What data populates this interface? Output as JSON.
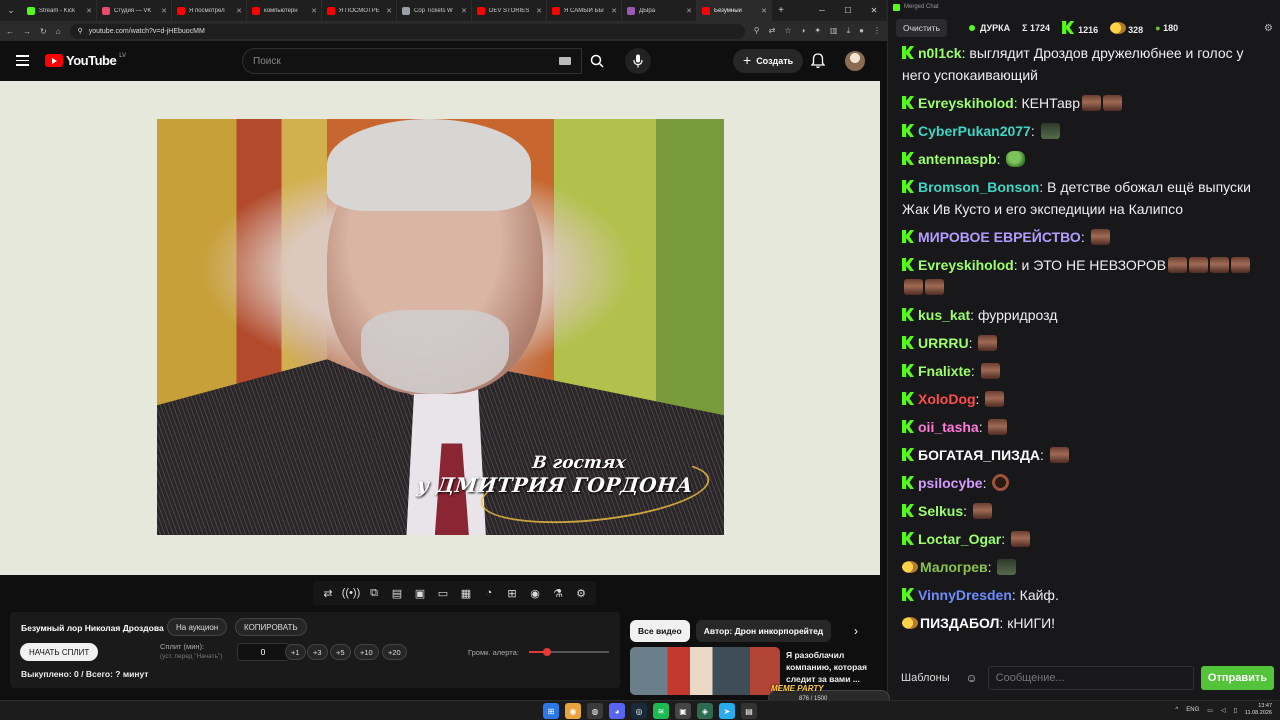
{
  "browser": {
    "tabs": [
      {
        "title": "Stream - Kick",
        "color": "#53fc18",
        "active": false
      },
      {
        "title": "Студия — VK",
        "color": "#e84a6a",
        "active": false
      },
      {
        "title": "Я посмотрел",
        "color": "#ff0000",
        "active": false
      },
      {
        "title": "компьютерн",
        "color": "#ff0000",
        "active": false
      },
      {
        "title": "Я ПОСМОТРЕ",
        "color": "#ff0000",
        "active": false
      },
      {
        "title": "Cop Tickets W",
        "color": "#9aa0a6",
        "active": false
      },
      {
        "title": "DEV STORIES",
        "color": "#ff0000",
        "active": false
      },
      {
        "title": "Я САМЫЙ БЫ",
        "color": "#ff0000",
        "active": false
      },
      {
        "title": "ДЫра",
        "color": "#9b59b6",
        "active": false
      },
      {
        "title": "Безумный",
        "color": "#ff0000",
        "active": true
      }
    ],
    "url": "youtube.com/watch?v=d-jHEbuocMM"
  },
  "youtube": {
    "logo_text": "YouTube",
    "country_code": "LV",
    "search_placeholder": "Поиск",
    "create_label": "Создать"
  },
  "video": {
    "caption_line1": "В гостях",
    "caption_line2": "у ДМИТРИЯ ГОРДОНА"
  },
  "toolbar_icons": [
    "loop-icon",
    "broadcast-icon",
    "cast-icon",
    "clapper-icon",
    "picture-frame-icon",
    "window-icon",
    "film-icon",
    "speedometer-icon",
    "add-clip-icon",
    "camera-icon",
    "flask-icon",
    "gear-icon"
  ],
  "split_panel": {
    "title": "Безумный лор Николая Дроздова",
    "auction_label": "На аукцион",
    "copy_label": "КОПИРОВАТЬ",
    "start_label": "НАЧАТЬ СПЛИТ",
    "split_label": "Сплит (мин):",
    "split_hint": "(уст. перед \"Начать\")",
    "split_value": "0",
    "increments": [
      "+1",
      "+3",
      "+5",
      "+10",
      "+20"
    ],
    "volume_label": "Громк. алерта:",
    "volume_level": 0.22,
    "status": "Выкуплено: 0 / Всего: ? минут"
  },
  "recommendations": {
    "chips": [
      "Все видео",
      "Автор: Дрон инкорпорейтед"
    ],
    "video_title": "Я разоблачил компанию, которая следит за вами ..."
  },
  "chat": {
    "window_title": "Merged Chat",
    "clear_label": "Очистить",
    "channel": "ДУРКА",
    "stat_sigma": "Σ 1724",
    "stat_k": "1216",
    "stat_t": "328",
    "stat_v": "180",
    "messages": [
      {
        "badge": "kick",
        "user": "n0l1ck",
        "color": "#9dff6b",
        "text": "выглядит Дроздов дружелюбнее и голос у него успокаивающий",
        "emotes": 0
      },
      {
        "badge": "kick",
        "user": "Evreyskiholod",
        "color": "#9dff6b",
        "text": "КЕНТавр",
        "emotes": 2
      },
      {
        "badge": "kick",
        "user": "CyberPukan2077",
        "color": "#3dd6c5",
        "text": "",
        "emotes": 1
      },
      {
        "badge": "kick",
        "user": "antennaspb",
        "color": "#9dff6b",
        "text": "",
        "emotes": 1
      },
      {
        "badge": "kick",
        "user": "Bromson_Bonson",
        "color": "#3dd6c5",
        "text": "В детстве обожал ещё выпуски Жак Ив Кусто и его экспедиции на Калипсо",
        "emotes": 0
      },
      {
        "badge": "kick",
        "user": "МИРОВОЕ ЕВРЕЙСТВО",
        "color": "#b39dff",
        "text": "",
        "emotes": 1
      },
      {
        "badge": "kick",
        "user": "Evreyskiholod",
        "color": "#9dff6b",
        "text": "и ЭТО НЕ НЕВЗОРОВ",
        "emotes": 6
      },
      {
        "badge": "kick",
        "user": "kus_kat",
        "color": "#9dff6b",
        "text": "фурридрозд",
        "emotes": 0
      },
      {
        "badge": "kick",
        "user": "URRRU",
        "color": "#9dff6b",
        "text": "",
        "emotes": 1
      },
      {
        "badge": "kick",
        "user": "Fnalixte",
        "color": "#9dff6b",
        "text": "",
        "emotes": 1
      },
      {
        "badge": "kick",
        "user": "XoloDog",
        "color": "#ff4d4d",
        "text": "",
        "emotes": 1
      },
      {
        "badge": "kick",
        "user": "oii_tasha",
        "color": "#ff7ad9",
        "text": "",
        "emotes": 1
      },
      {
        "badge": "kick",
        "user": "БОГАТАЯ_ПИЗДА",
        "color": "#ffffff",
        "text": "",
        "emotes": 1
      },
      {
        "badge": "kick",
        "user": "psilocybe",
        "color": "#d59bff",
        "text": "",
        "emotes": 1
      },
      {
        "badge": "kick",
        "user": "Selkus",
        "color": "#9dff6b",
        "text": "",
        "emotes": 1
      },
      {
        "badge": "kick",
        "user": "Loctar_Ogar",
        "color": "#9dff6b",
        "text": "",
        "emotes": 1
      },
      {
        "badge": "twitch",
        "user": "Малогрев",
        "color": "#8bc34a",
        "text": "",
        "emotes": 1
      },
      {
        "badge": "kick",
        "user": "VinnyDresden",
        "color": "#6f8cff",
        "text": "Кайф.",
        "emotes": 0
      },
      {
        "badge": "twitch",
        "user": "ПИЗДАБОЛ",
        "color": "#ffffff",
        "text": "кНИГИ!",
        "emotes": 0
      }
    ],
    "templates_label": "Шаблоны",
    "input_placeholder": "Сообщение...",
    "send_label": "Отправить"
  },
  "taskbar": {
    "widget_logo": "MEME PARTY",
    "widget_progress": "876 / 1500",
    "lang": "ENG",
    "time": "13:47",
    "date": "11.08.2026"
  }
}
